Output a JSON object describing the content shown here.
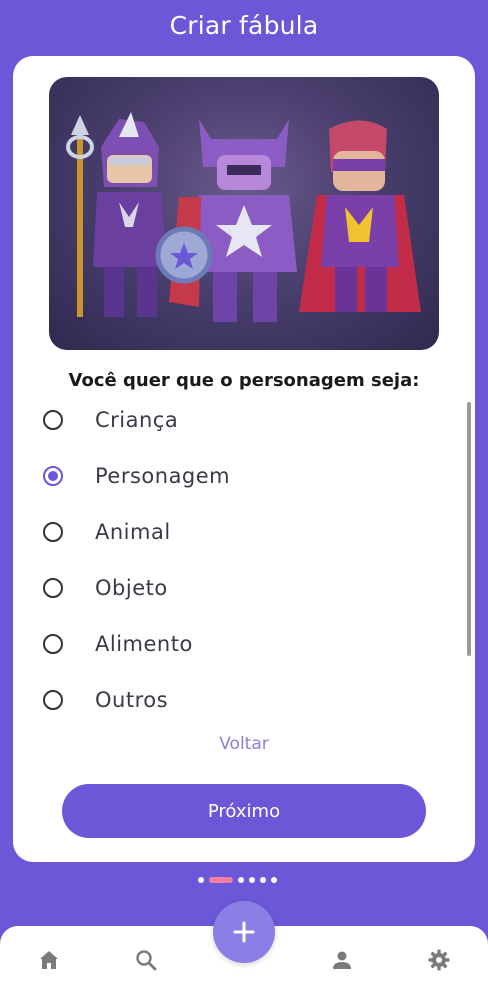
{
  "header": {
    "title": "Criar fábula"
  },
  "question": "Você quer que o personagem seja:",
  "options": [
    {
      "label": "Criança",
      "selected": false
    },
    {
      "label": "Personagem",
      "selected": true
    },
    {
      "label": "Animal",
      "selected": false
    },
    {
      "label": "Objeto",
      "selected": false
    },
    {
      "label": "Alimento",
      "selected": false
    },
    {
      "label": "Outros",
      "selected": false
    }
  ],
  "back_label": "Voltar",
  "next_label": "Próximo",
  "pagination": {
    "total": 6,
    "active_index": 1
  },
  "bottom_nav": {
    "items": [
      "home-icon",
      "search-icon",
      "user-icon",
      "gear-icon"
    ],
    "fab": "plus-icon"
  },
  "colors": {
    "primary": "#6a58d8",
    "accent_dot": "#f27fa0",
    "link": "#8b7fd8",
    "fab": "#8b7fe6"
  }
}
